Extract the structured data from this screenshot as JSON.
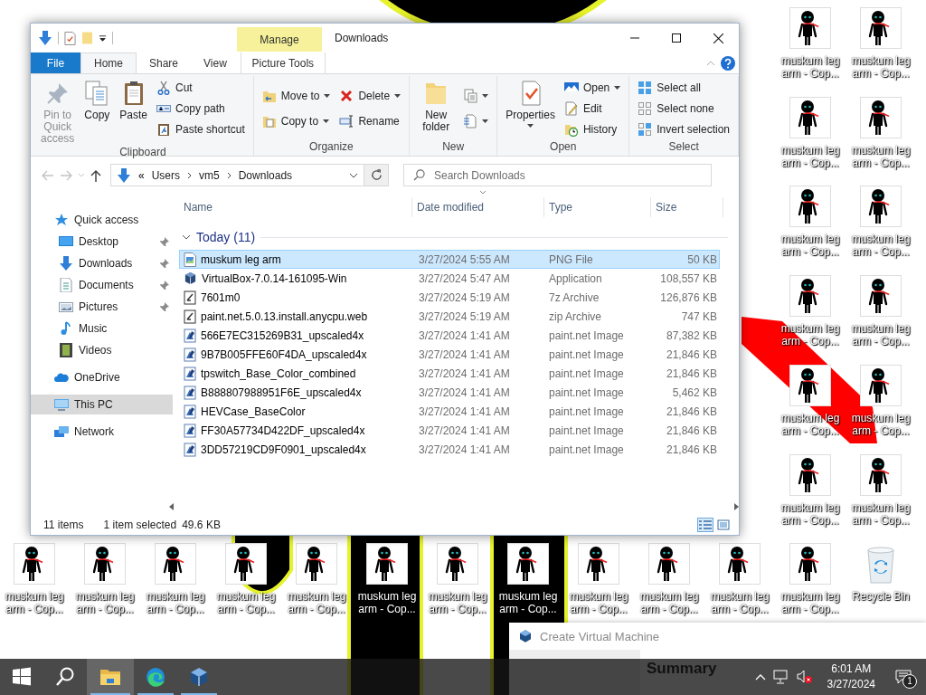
{
  "desktop": {
    "icons": [
      {
        "label": "muskum leg arm - Cop...",
        "kind": "image"
      },
      {
        "label": "muskum leg arm - Cop...",
        "kind": "image"
      },
      {
        "label": "muskum leg arm - Cop...",
        "kind": "image"
      },
      {
        "label": "muskum leg arm - Cop...",
        "kind": "image"
      },
      {
        "label": "muskum leg arm - Cop...",
        "kind": "image"
      },
      {
        "label": "muskum leg arm - Cop...",
        "kind": "image"
      },
      {
        "label": "muskum leg arm - Cop...",
        "kind": "image"
      },
      {
        "label": "muskum leg arm - Cop...",
        "kind": "image"
      },
      {
        "label": "muskum leg arm - Cop...",
        "kind": "image"
      },
      {
        "label": "muskum leg arm - Cop...",
        "kind": "image"
      },
      {
        "label": "muskum leg arm - Cop...",
        "kind": "image"
      },
      {
        "label": "muskum leg arm - Cop...",
        "kind": "image"
      },
      {
        "label": "muskum leg arm - Cop...",
        "kind": "image"
      },
      {
        "label": "muskum leg arm - Cop...",
        "kind": "image"
      },
      {
        "label": "muskum leg arm - Cop...",
        "kind": "image"
      },
      {
        "label": "muskum leg arm - Cop...",
        "kind": "image"
      },
      {
        "label": "muskum leg arm - Cop...",
        "kind": "image"
      },
      {
        "label": "muskum leg arm - Cop...",
        "kind": "image"
      },
      {
        "label": "muskum leg arm - Cop...",
        "kind": "image"
      },
      {
        "label": "muskum leg arm - Cop...",
        "kind": "image"
      },
      {
        "label": "muskum leg arm - Cop...",
        "kind": "image"
      },
      {
        "label": "muskum leg arm - Cop...",
        "kind": "image"
      },
      {
        "label": "muskum leg arm - Cop...",
        "kind": "image"
      },
      {
        "label": "muskum leg arm - Cop...",
        "kind": "image"
      },
      {
        "label": "Recycle Bin",
        "kind": "recycle-bin"
      }
    ]
  },
  "explorer": {
    "title": "Downloads",
    "context_tab": {
      "label": "Manage"
    },
    "tabs": [
      {
        "label": "File",
        "kind": "file",
        "selected": false
      },
      {
        "label": "Home",
        "kind": "normal",
        "selected": true
      },
      {
        "label": "Share",
        "kind": "normal",
        "selected": false
      },
      {
        "label": "View",
        "kind": "normal",
        "selected": false
      },
      {
        "label": "Picture Tools",
        "kind": "context",
        "selected": false
      }
    ],
    "ribbon": {
      "groups": [
        {
          "label": "Clipboard",
          "large": [
            {
              "label": "Pin to Quick access",
              "disabled": true,
              "dropdown": false
            },
            {
              "label": "Copy",
              "disabled": false,
              "dropdown": false
            },
            {
              "label": "Paste",
              "disabled": false,
              "dropdown": false
            }
          ],
          "columns": [
            [
              {
                "label": "Cut",
                "dropdown": false
              },
              {
                "label": "Copy path",
                "dropdown": false
              },
              {
                "label": "Paste shortcut",
                "dropdown": false
              }
            ]
          ]
        },
        {
          "label": "Organize",
          "columns": [
            [
              {
                "label": "Move to",
                "dropdown": true
              },
              {
                "label": "Copy to",
                "dropdown": true
              }
            ],
            [
              {
                "label": "Delete",
                "dropdown": true
              },
              {
                "label": "Rename",
                "dropdown": false
              }
            ]
          ]
        },
        {
          "label": "New",
          "large": [
            {
              "label": "New folder",
              "disabled": false,
              "dropdown": false
            }
          ],
          "columns": [
            [
              {
                "dropdown": true
              },
              {
                "dropdown": true
              }
            ]
          ]
        },
        {
          "label": "Open",
          "large": [
            {
              "label": "Properties",
              "disabled": false,
              "dropdown": true
            }
          ],
          "columns": [
            [
              {
                "label": "Open",
                "dropdown": true
              },
              {
                "label": "Edit",
                "dropdown": false
              },
              {
                "label": "History",
                "dropdown": false
              }
            ]
          ]
        },
        {
          "label": "Select",
          "columns": [
            [
              {
                "label": "Select all",
                "dropdown": false
              },
              {
                "label": "Select none",
                "dropdown": false
              },
              {
                "label": "Invert selection",
                "dropdown": false
              }
            ]
          ]
        }
      ]
    },
    "address": {
      "overflow": "«",
      "crumbs": [
        "Users",
        "vm5",
        "Downloads"
      ]
    },
    "search": {
      "placeholder": "Search Downloads"
    },
    "columns": [
      "Name",
      "Date modified",
      "Type",
      "Size"
    ],
    "group": {
      "label": "Today (11)",
      "expanded": true
    },
    "files": [
      {
        "name": "muskum leg arm",
        "date": "3/27/2024 5:55 AM",
        "type": "PNG File",
        "size": "50 KB",
        "kind": "png",
        "selected": true
      },
      {
        "name": "VirtualBox-7.0.14-161095-Win",
        "date": "3/27/2024 5:47 AM",
        "type": "Application",
        "size": "108,557 KB",
        "kind": "app",
        "selected": false
      },
      {
        "name": "7601m0",
        "date": "3/27/2024 5:19 AM",
        "type": "7z Archive",
        "size": "126,876 KB",
        "kind": "archive",
        "selected": false
      },
      {
        "name": "paint.net.5.0.13.install.anycpu.web",
        "date": "3/27/2024 5:19 AM",
        "type": "zip Archive",
        "size": "747 KB",
        "kind": "archive",
        "selected": false
      },
      {
        "name": "566E7EC315269B31_upscaled4x",
        "date": "3/27/2024 1:41 AM",
        "type": "paint.net Image",
        "size": "87,382 KB",
        "kind": "pdn",
        "selected": false
      },
      {
        "name": "9B7B005FFE60F4DA_upscaled4x",
        "date": "3/27/2024 1:41 AM",
        "type": "paint.net Image",
        "size": "21,846 KB",
        "kind": "pdn",
        "selected": false
      },
      {
        "name": "tpswitch_Base_Color_combined",
        "date": "3/27/2024 1:41 AM",
        "type": "paint.net Image",
        "size": "21,846 KB",
        "kind": "pdn",
        "selected": false
      },
      {
        "name": "B888807988951F6E_upscaled4x",
        "date": "3/27/2024 1:41 AM",
        "type": "paint.net Image",
        "size": "5,462 KB",
        "kind": "pdn",
        "selected": false
      },
      {
        "name": "HEVCase_BaseColor",
        "date": "3/27/2024 1:41 AM",
        "type": "paint.net Image",
        "size": "21,846 KB",
        "kind": "pdn",
        "selected": false
      },
      {
        "name": "FF30A57734D422DF_upscaled4x",
        "date": "3/27/2024 1:41 AM",
        "type": "paint.net Image",
        "size": "21,846 KB",
        "kind": "pdn",
        "selected": false
      },
      {
        "name": "3DD57219CD9F0901_upscaled4x",
        "date": "3/27/2024 1:41 AM",
        "type": "paint.net Image",
        "size": "21,846 KB",
        "kind": "pdn",
        "selected": false
      }
    ],
    "nav": [
      {
        "label": "Quick access",
        "selected": false,
        "children": [
          {
            "label": "Desktop",
            "pinned": true,
            "selected": false
          },
          {
            "label": "Downloads",
            "pinned": true,
            "selected": false
          },
          {
            "label": "Documents",
            "pinned": true,
            "selected": false
          },
          {
            "label": "Pictures",
            "pinned": true,
            "selected": false
          },
          {
            "label": "Music",
            "pinned": false,
            "selected": false
          },
          {
            "label": "Videos",
            "pinned": false,
            "selected": false
          }
        ]
      },
      {
        "label": "OneDrive",
        "selected": false
      },
      {
        "label": "This PC",
        "selected": true
      },
      {
        "label": "Network",
        "selected": false
      }
    ],
    "status": {
      "count": "11 items",
      "selection": "1 item selected",
      "size": "49.6 KB"
    },
    "view_modes": [
      {
        "selected": true
      },
      {
        "selected": false
      }
    ]
  },
  "vm_window": {
    "title": "Create Virtual Machine",
    "heading": "Summary"
  },
  "taskbar": {
    "apps": [
      {
        "active": false,
        "running": false
      },
      {
        "active": false,
        "running": false
      },
      {
        "active": true,
        "running": true
      },
      {
        "active": false,
        "running": true
      },
      {
        "active": false,
        "running": true
      }
    ],
    "time": "6:01 AM",
    "date": "3/27/2024",
    "notifications": "1"
  }
}
